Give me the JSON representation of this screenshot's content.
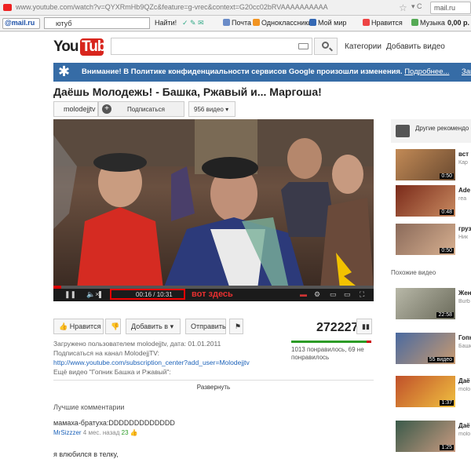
{
  "browser": {
    "url": "www.youtube.com/watch?v=QYXRmHb9QZc&feature=g-vrec&context=G20cc02bRVAAAAAAAAAA",
    "search_placeholder": "mail.ru"
  },
  "toolbar": {
    "brand": "@mail.ru",
    "search_value": "ютуб",
    "find": "Найти!",
    "items": [
      "Почта",
      "Одноклассники",
      "Мой мир",
      "Нравится",
      "Музыка",
      "0,00 р."
    ]
  },
  "header": {
    "logo_you": "You",
    "logo_tube": "Tube",
    "categories": "Категории",
    "add_video": "Добавить видео"
  },
  "notice": {
    "text": "Внимание! В Политике конфиденциальности сервисов Google произошли изменения.",
    "more": "Подробнее...",
    "close": "Закрыть"
  },
  "video": {
    "title": "Даёшь Молодежь! - Башка, Ржавый и... Маргоша!",
    "channel": "molodejjtv",
    "subscribe": "Подписаться",
    "video_count": "956 видео",
    "time_current": "00:16",
    "time_total": "10:31",
    "progress": 0.025,
    "annotation": "вот здесь"
  },
  "actions": {
    "like": "Нравится",
    "add": "Добавить в",
    "share": "Отправить",
    "views": "272227",
    "like_ratio": 0.94,
    "likes_text": "1013 понравилось, 69 не понравилось"
  },
  "description": {
    "uploaded": "Загружено пользователем molodejjtv, дата: 01.01.2011",
    "line1": "Подписаться на канал MolodejjTV:",
    "link": "http://www.youtube.com/subscription_center?add_user=Molodejjtv",
    "line3": "Ещё видео \"Гопник Башка и Ржавый\":",
    "expand": "Развернуть"
  },
  "comments": {
    "heading": "Лучшие комментарии",
    "c1_text": "мамаха-братуха:DDDDDDDDDDDDD",
    "c1_user": "MrSizzzer",
    "c1_time": "4 мес. назад",
    "c1_votes": "23",
    "c2_text": "я влюбился в телку,"
  },
  "sidebar": {
    "heading": "Другие рекомендо",
    "similar": "Похожие видео",
    "items": [
      {
        "title": "вст",
        "channel": "Кар",
        "duration": "0:50"
      },
      {
        "title": "Ade",
        "channel": "rea",
        "duration": "0:48"
      },
      {
        "title": "груз",
        "channel": "Ник",
        "duration": "0:50"
      },
      {
        "title": "Жен",
        "channel": "Burb",
        "duration": "22:58"
      },
      {
        "title": "Гопн",
        "channel": "Башк",
        "duration": "55 видео"
      },
      {
        "title": "Даё",
        "channel": "molo",
        "duration": "1:37"
      },
      {
        "title": "Даё",
        "channel": "molo",
        "duration": "1:25"
      }
    ]
  }
}
